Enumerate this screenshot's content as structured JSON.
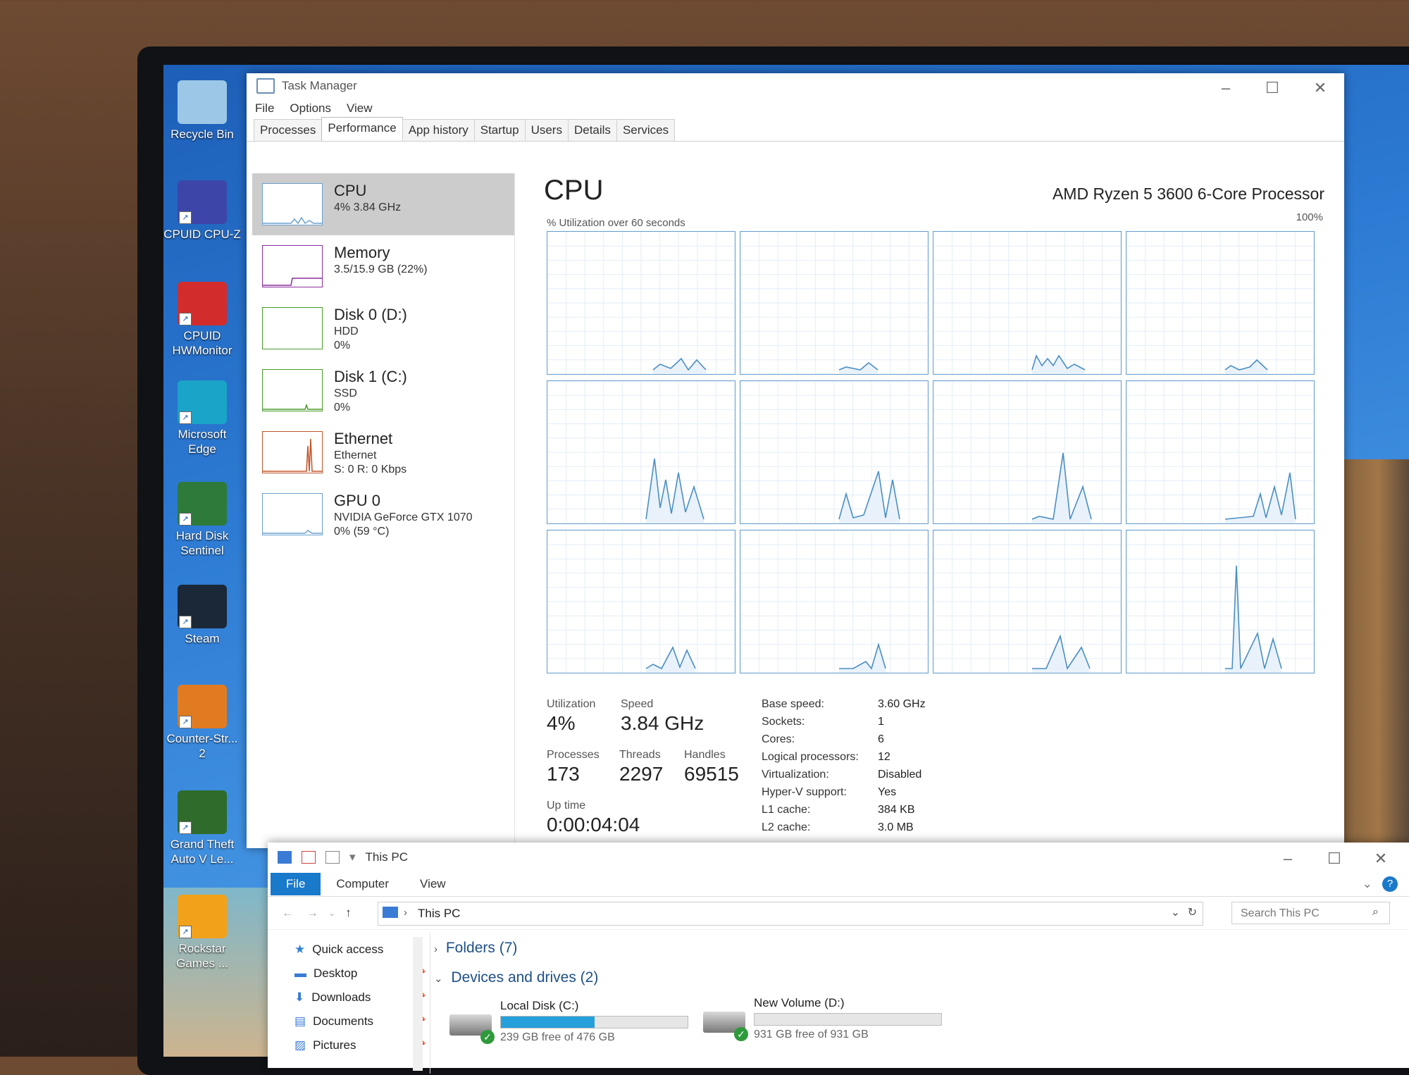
{
  "desktop": {
    "icons": [
      {
        "label": "Recycle Bin",
        "icon": "recycle-bin-icon",
        "color": "#9cc7e6"
      },
      {
        "label": "CPUID CPU-Z",
        "icon": "cpuz-icon",
        "color": "#3d46a8"
      },
      {
        "label": "CPUID HWMonitor",
        "icon": "hwmonitor-icon",
        "color": "#d22c2c"
      },
      {
        "label": "Microsoft Edge",
        "icon": "edge-icon",
        "color": "#1aa4c8"
      },
      {
        "label": "Hard Disk Sentinel",
        "icon": "hard-disk-sentinel-icon",
        "color": "#2d7a3a"
      },
      {
        "label": "Steam",
        "icon": "steam-icon",
        "color": "#1b2838"
      },
      {
        "label": "Counter-Str... 2",
        "icon": "counter-strike-icon",
        "color": "#e07b22"
      },
      {
        "label": "Grand Theft Auto V Le...",
        "icon": "gta-v-icon",
        "color": "#2f6b2a"
      },
      {
        "label": "Rockstar Games ...",
        "icon": "rockstar-icon",
        "color": "#f2a21a"
      }
    ]
  },
  "task_manager": {
    "title": "Task Manager",
    "menu": [
      "File",
      "Options",
      "View"
    ],
    "tabs": [
      "Processes",
      "Performance",
      "App history",
      "Startup",
      "Users",
      "Details",
      "Services"
    ],
    "active_tab": "Performance",
    "sidebar": [
      {
        "name": "CPU",
        "line1": "4% 3.84 GHz",
        "line2": "",
        "color": "#6aa0cf",
        "selected": true
      },
      {
        "name": "Memory",
        "line1": "3.5/15.9 GB (22%)",
        "line2": "",
        "color": "#8b2f9c"
      },
      {
        "name": "Disk 0 (D:)",
        "line1": "HDD",
        "line2": "0%",
        "color": "#4a9a2a"
      },
      {
        "name": "Disk 1 (C:)",
        "line1": "SSD",
        "line2": "0%",
        "color": "#4a9a2a"
      },
      {
        "name": "Ethernet",
        "line1": "Ethernet",
        "line2": "S: 0 R: 0 Kbps",
        "color": "#c0562a"
      },
      {
        "name": "GPU 0",
        "line1": "NVIDIA GeForce GTX 1070",
        "line2": "0% (59 °C)",
        "color": "#6aa0cf"
      }
    ],
    "cpu": {
      "heading": "CPU",
      "model": "AMD Ryzen 5 3600 6-Core Processor",
      "graph_label": "% Utilization over 60 seconds",
      "max_label": "100%",
      "cores": 12,
      "stats": {
        "utilization_label": "Utilization",
        "utilization": "4%",
        "speed_label": "Speed",
        "speed": "3.84 GHz",
        "processes_label": "Processes",
        "processes": "173",
        "threads_label": "Threads",
        "threads": "2297",
        "handles_label": "Handles",
        "handles": "69515",
        "uptime_label": "Up time",
        "uptime": "0:00:04:04"
      },
      "details": [
        {
          "k": "Base speed:",
          "v": "3.60 GHz"
        },
        {
          "k": "Sockets:",
          "v": "1"
        },
        {
          "k": "Cores:",
          "v": "6"
        },
        {
          "k": "Logical processors:",
          "v": "12"
        },
        {
          "k": "Virtualization:",
          "v": "Disabled"
        },
        {
          "k": "Hyper-V support:",
          "v": "Yes"
        },
        {
          "k": "L1 cache:",
          "v": "384 KB"
        },
        {
          "k": "L2 cache:",
          "v": "3.0 MB"
        }
      ]
    }
  },
  "explorer": {
    "title": "This PC",
    "ribbon": [
      "File",
      "Computer",
      "View"
    ],
    "address": "This PC",
    "search_placeholder": "Search This PC",
    "nav": [
      {
        "label": "Quick access",
        "icon": "star-icon"
      },
      {
        "label": "Desktop",
        "icon": "desktop-folder-icon"
      },
      {
        "label": "Downloads",
        "icon": "download-arrow-icon"
      },
      {
        "label": "Documents",
        "icon": "document-icon"
      },
      {
        "label": "Pictures",
        "icon": "pictures-icon"
      }
    ],
    "folders_section": "Folders (7)",
    "devices_section": "Devices and drives (2)",
    "drives": [
      {
        "label": "Local Disk (C:)",
        "free": "239 GB free of 476 GB",
        "used_fraction": 0.5
      },
      {
        "label": "New Volume (D:)",
        "free": "931 GB free of 931 GB",
        "used_fraction": 0.0
      }
    ]
  }
}
